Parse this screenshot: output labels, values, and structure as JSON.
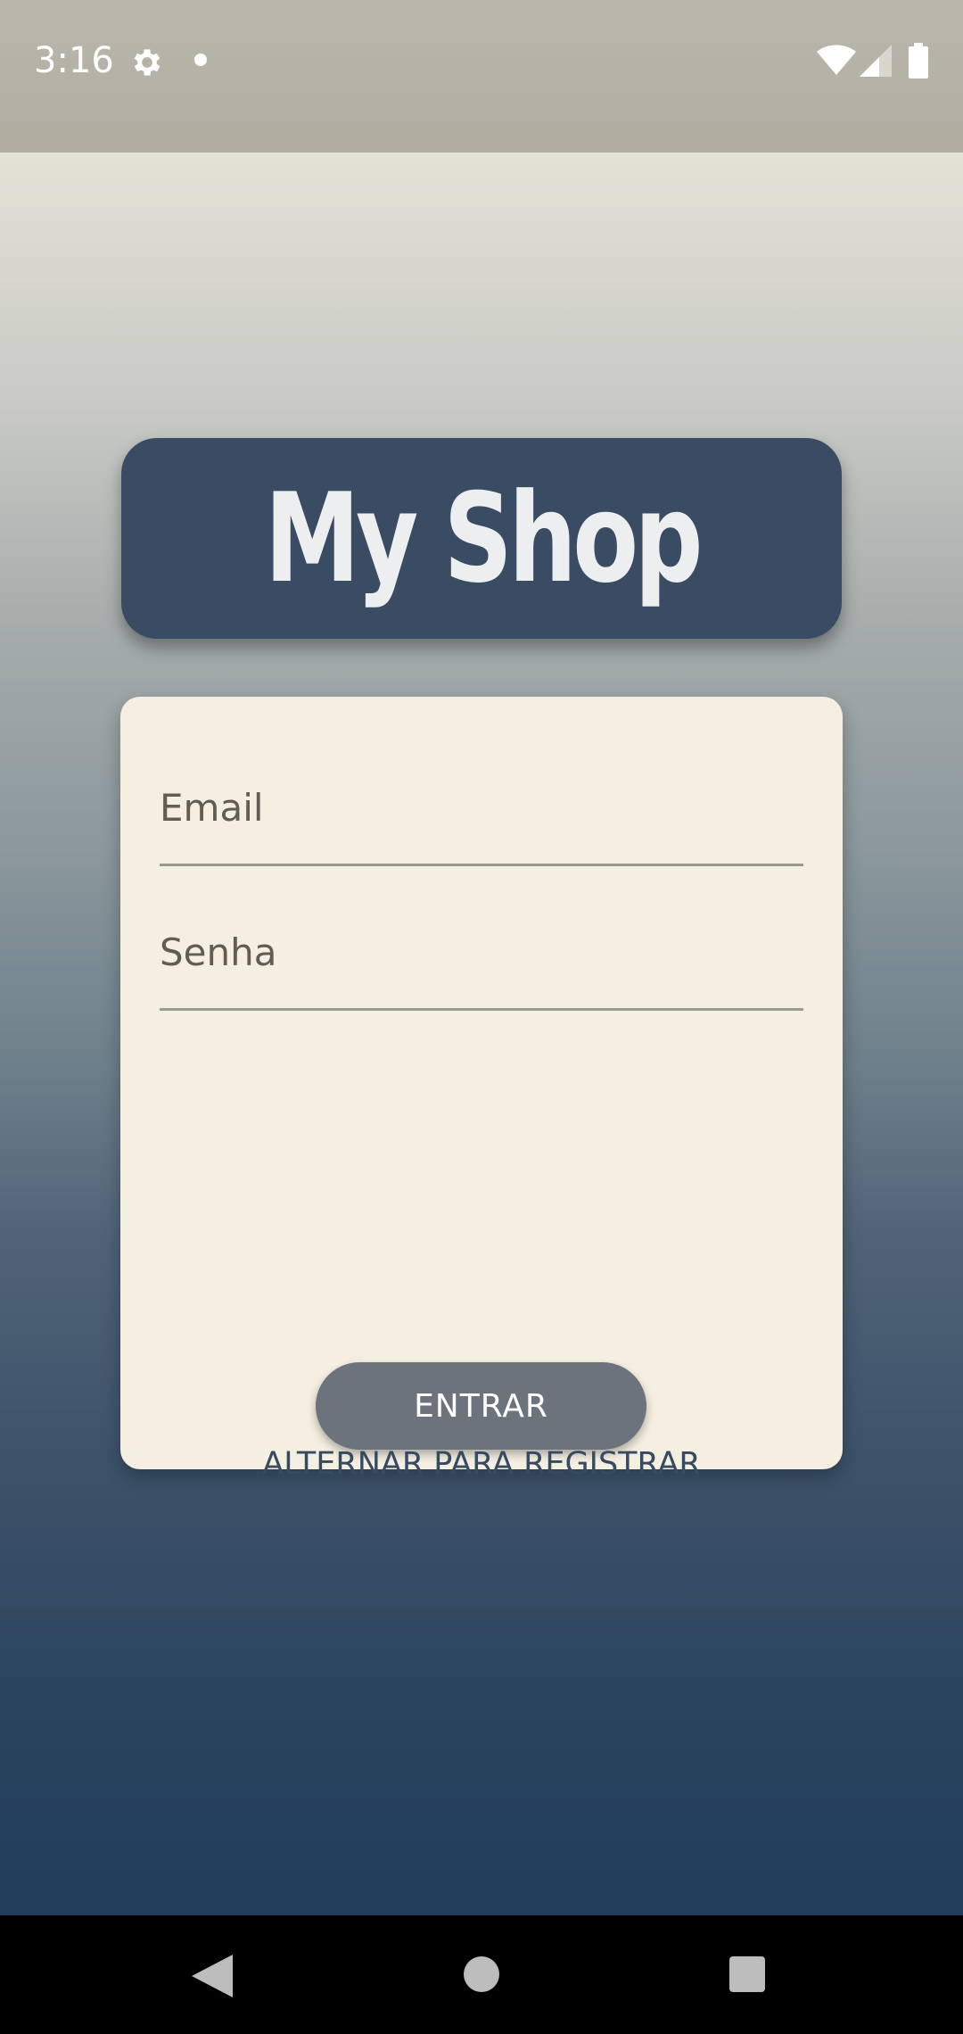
{
  "status_bar": {
    "time": "3:16",
    "icons": [
      "gear-icon",
      "notification-dot-icon",
      "wifi-icon",
      "signal-icon",
      "battery-icon"
    ]
  },
  "app": {
    "title": "My Shop",
    "form": {
      "email_label": "Email",
      "password_label": "Senha",
      "submit_label": "ENTRAR",
      "switch_label": "ALTERNAR PARA REGISTRAR"
    }
  },
  "nav_bar": {
    "icons": [
      "back-icon",
      "home-icon",
      "recents-icon"
    ]
  },
  "colors": {
    "title_card": "#3a4c63",
    "form_card": "#f5efe2",
    "submit_button": "#6d737d",
    "switch_text": "#364a61"
  }
}
